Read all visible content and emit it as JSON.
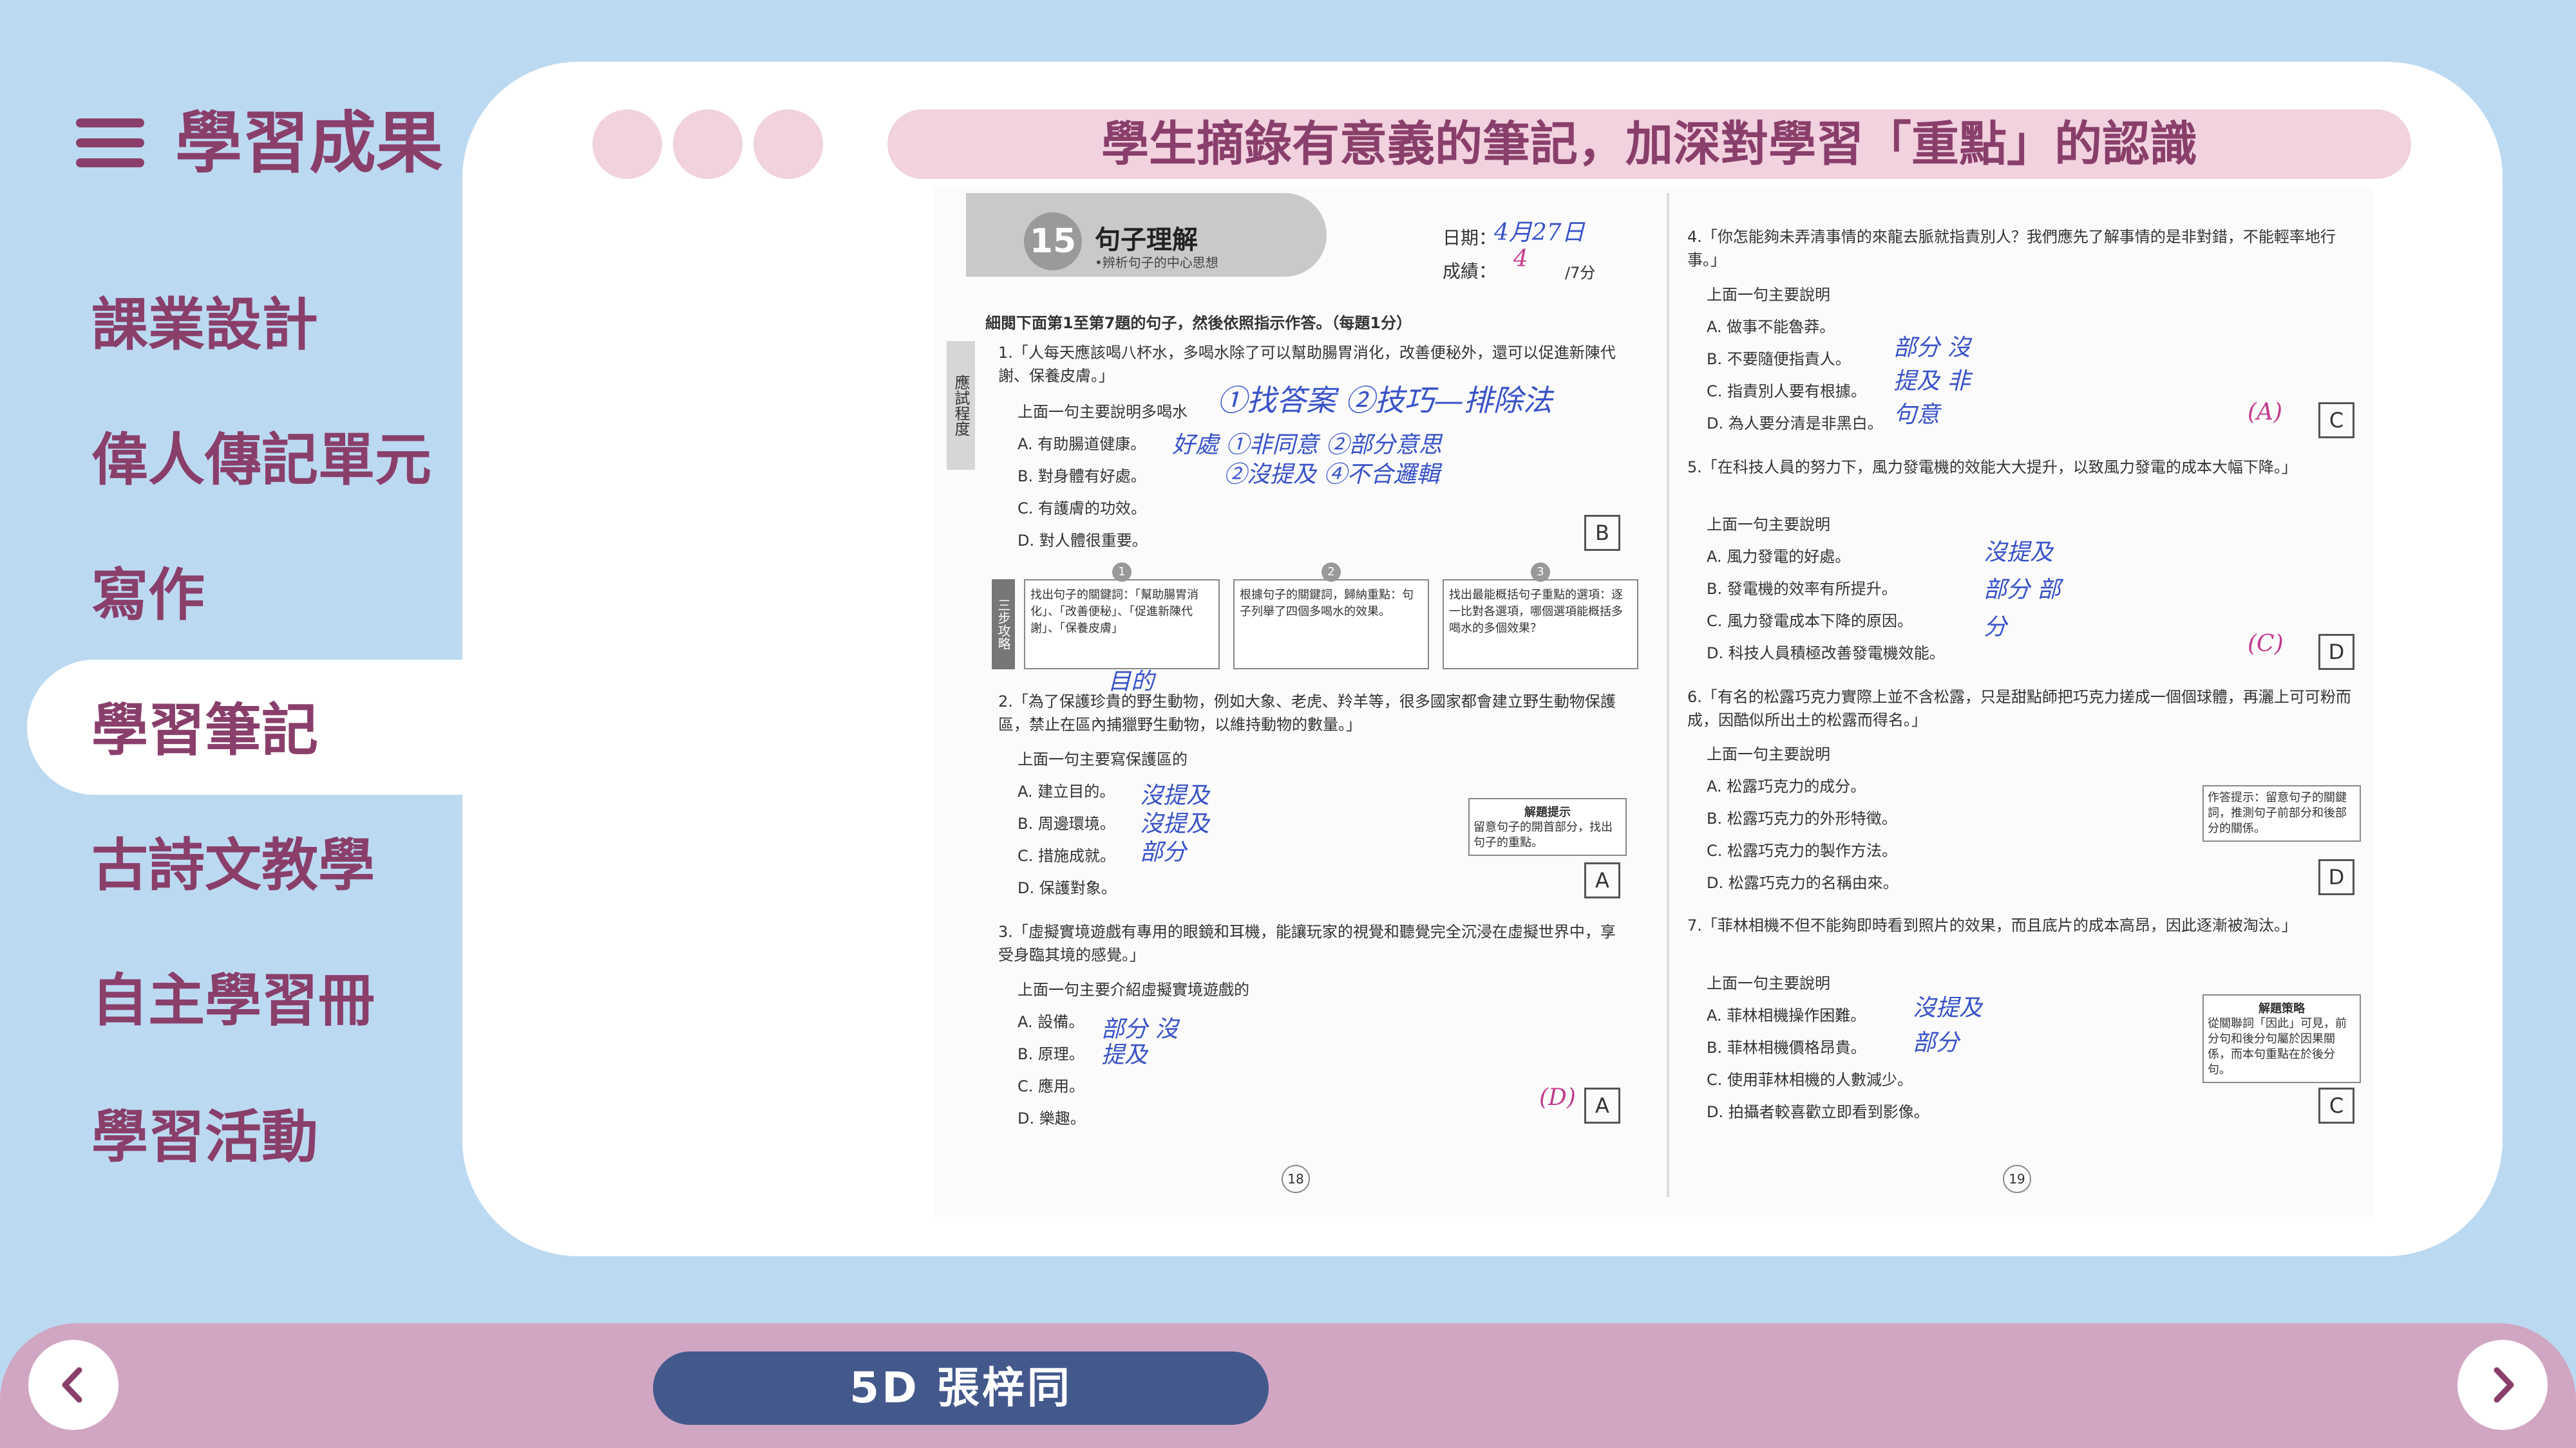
{
  "header": {
    "title": "學習成果",
    "menu_icon": "hamburger-menu-icon"
  },
  "sidebar": {
    "items": [
      {
        "label": "課業設計",
        "active": false
      },
      {
        "label": "偉人傳記單元",
        "active": false
      },
      {
        "label": "寫作",
        "active": false
      },
      {
        "label": "學習筆記",
        "active": true
      },
      {
        "label": "古詩文教學",
        "active": false
      },
      {
        "label": "自主學習冊",
        "active": false
      },
      {
        "label": "學習活動",
        "active": false
      }
    ]
  },
  "main": {
    "banner": "學生摘錄有意義的筆記，加深對學習「重點」的認識",
    "worksheet": {
      "lesson_number": "15",
      "lesson_title": "句子理解",
      "lesson_subtitle": "•辨析句子的中心思想",
      "side_tab": "應試程度",
      "date_label": "日期：",
      "date_value": "4月27日",
      "score_label": "成績：",
      "score_value": "4",
      "score_total": "/7分",
      "instruction": "細閱下面第1至第7題的句子，然後依照指示作答。（每題1分）",
      "q1": "1.「人每天應該喝八杯水，多喝水除了可以幫助腸胃消化，改善便秘外，還可以促進新陳代謝、保養皮膚。」",
      "q1_prompt": "上面一句主要說明多喝水",
      "q1_options": [
        "A. 有助腸道健康。",
        "B. 對身體有好處。",
        "C. 有護膚的功效。",
        "D. 對人體很重要。"
      ],
      "q1_answer": "B",
      "q1_note_1": "①找答案 ②技巧—排除法",
      "q1_note_2": "好處 ①非同意 ②部分意思",
      "q1_note_3": "②沒提及 ④不合邏輯",
      "steps_tab": "三步攻略",
      "steps": [
        "找出句子的關鍵詞：「幫助腸胃消化」、「改善便秘」、「促進新陳代謝」、「保養皮膚」",
        "根據句子的關鍵詞，歸納重點：句子列舉了四個多喝水的效果。",
        "找出最能概括句子重點的選項：逐一比對各選項，哪個選項能概括多喝水的多個效果？"
      ],
      "q2": "2.「為了保護珍貴的野生動物，例如大象、老虎、羚羊等，很多國家都會建立野生動物保護區，禁止在區內捕獵野生動物，以維持動物的數量。」",
      "q2_prompt": "上面一句主要寫保護區的",
      "q2_options": [
        "A. 建立目的。",
        "B. 周邊環境。",
        "C. 措施成就。",
        "D. 保護對象。"
      ],
      "q2_answer": "A",
      "q2_note_top": "目的",
      "q2_note": "沒提及 沒提及 部分",
      "q2_hint_title": "解題提示",
      "q2_hint": "留意句子的開首部分，找出句子的重點。",
      "q3": "3.「虛擬實境遊戲有專用的眼鏡和耳機，能讓玩家的視覺和聽覺完全沉浸在虛擬世界中，享受身臨其境的感覺。」",
      "q3_prompt": "上面一句主要介紹虛擬實境遊戲的",
      "q3_options": [
        "A. 設備。",
        "B. 原理。",
        "C. 應用。",
        "D. 樂趣。"
      ],
      "q3_answer": "A",
      "q3_wrong": "(D)",
      "q3_note": "部分 沒提及",
      "page_left": "18",
      "q4": "4.「你怎能夠未弄清事情的來龍去脈就指責別人？我們應先了解事情的是非對錯，不能輕率地行事。」",
      "q4_prompt": "上面一句主要說明",
      "q4_options": [
        "A. 做事不能魯莽。",
        "B. 不要隨便指責人。",
        "C. 指責別人要有根據。",
        "D. 為人要分清是非黑白。"
      ],
      "q4_answer": "C",
      "q4_note": "部分 沒提及 非句意",
      "q4_wrong": "(A)",
      "q5": "5.「在科技人員的努力下，風力發電機的效能大大提升，以致風力發電的成本大幅下降。」",
      "q5_prompt": "上面一句主要說明",
      "q5_options": [
        "A. 風力發電的好處。",
        "B. 發電機的效率有所提升。",
        "C. 風力發電成本下降的原因。",
        "D. 科技人員積極改善發電機效能。"
      ],
      "q5_answer": "D",
      "q5_wrong": "(C)",
      "q5_note": "沒提及 部分 部分",
      "q6": "6.「有名的松露巧克力實際上並不含松露，只是甜點師把巧克力搓成一個個球體，再灑上可可粉而成，因酷似所出土的松露而得名。」",
      "q6_prompt": "上面一句主要說明",
      "q6_options": [
        "A. 松露巧克力的成分。",
        "B. 松露巧克力的外形特徵。",
        "C. 松露巧克力的製作方法。",
        "D. 松露巧克力的名稱由來。"
      ],
      "q6_answer": "D",
      "q6_hint": "作答提示：留意句子的關鍵詞，推測句子前部分和後部分的關係。",
      "q7": "7.「菲林相機不但不能夠即時看到照片的效果，而且底片的成本高昂，因此逐漸被淘汰。」",
      "q7_prompt": "上面一句主要說明",
      "q7_options": [
        "A. 菲林相機操作困難。",
        "B. 菲林相機價格昂貴。",
        "C. 使用菲林相機的人數減少。",
        "D. 拍攝者較喜歡立即看到影像。"
      ],
      "q7_answer": "C",
      "q7_note": "沒提及 部分",
      "q7_hint_title": "解題策略",
      "q7_hint": "從關聯詞「因此」可見，前分句和後分句屬於因果關係，而本句重點在於後分句。",
      "page_right": "19"
    }
  },
  "footer": {
    "student": "5D 張梓同",
    "prev_icon": "chevron-left-icon",
    "next_icon": "chevron-right-icon"
  },
  "colors": {
    "background": "#bcd9f2",
    "accent": "#8a3f6b",
    "banner_pink": "#f1d2de",
    "footer_pink": "#d1a6c3",
    "pill_navy": "#43598c"
  }
}
